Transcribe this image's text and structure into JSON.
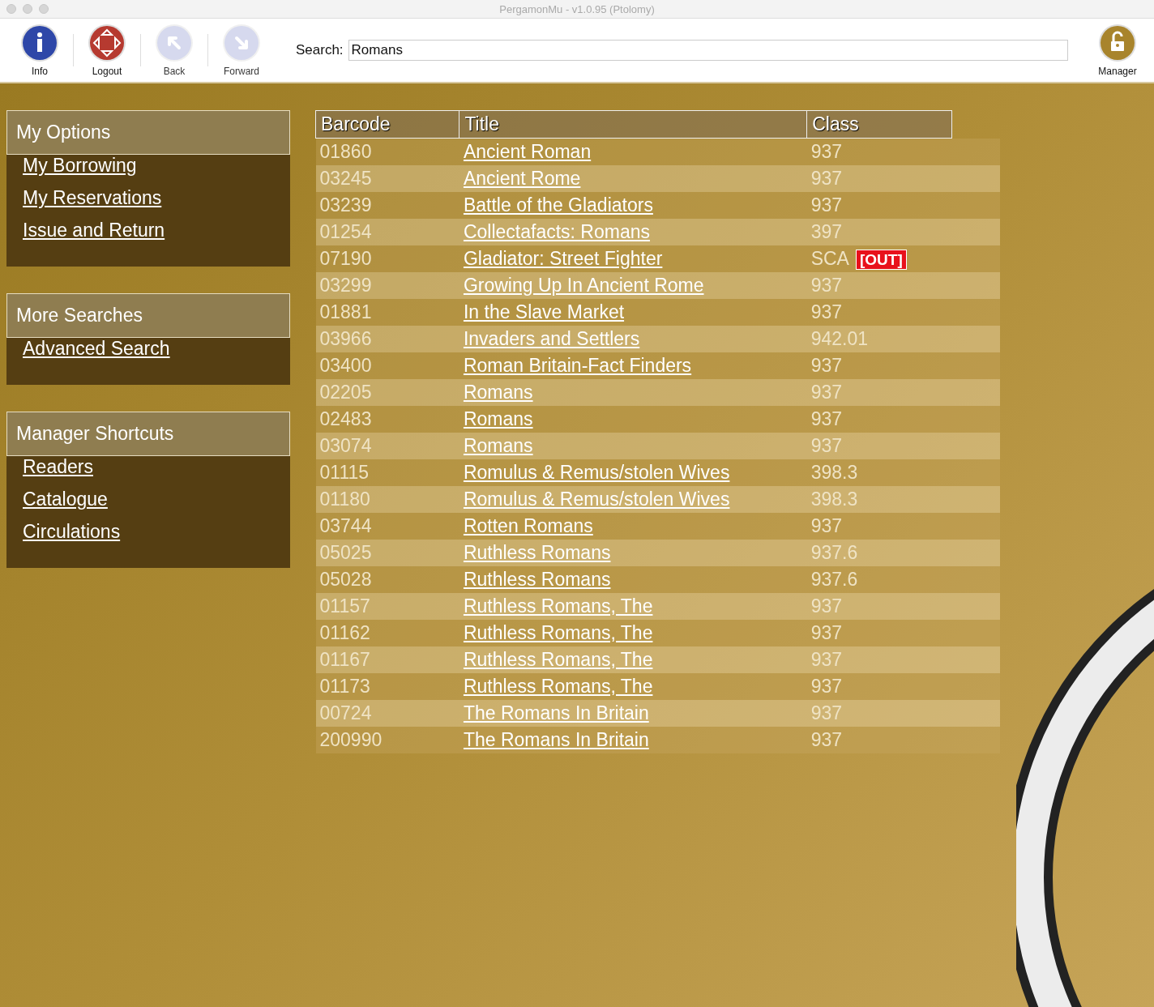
{
  "window": {
    "title": "PergamonMu - v1.0.95 (Ptolomy)"
  },
  "toolbar": {
    "buttons": [
      {
        "kind": "info",
        "label": "Info",
        "disabled": false
      },
      {
        "kind": "logout",
        "label": "Logout",
        "disabled": false
      },
      {
        "kind": "back",
        "label": "Back",
        "disabled": true
      },
      {
        "kind": "forward",
        "label": "Forward",
        "disabled": true
      }
    ],
    "search": {
      "label": "Search:",
      "value": "Romans"
    },
    "manager": {
      "label": "Manager"
    }
  },
  "sidebar": [
    {
      "title": "My Options",
      "links": [
        "My Borrowing",
        "My Reservations",
        "Issue and Return"
      ]
    },
    {
      "title": "More Searches",
      "links": [
        "Advanced Search"
      ]
    },
    {
      "title": "Manager Shortcuts",
      "links": [
        "Readers",
        "Catalogue",
        "Circulations"
      ]
    }
  ],
  "table": {
    "columns": [
      "Barcode",
      "Title",
      "Class"
    ],
    "rows": [
      {
        "barcode": "01860",
        "title": "Ancient Roman",
        "class": "937"
      },
      {
        "barcode": "03245",
        "title": "Ancient Rome",
        "class": "937"
      },
      {
        "barcode": "03239",
        "title": "Battle of the Gladiators",
        "class": "937"
      },
      {
        "barcode": "01254",
        "title": "Collectafacts: Romans",
        "class": "397"
      },
      {
        "barcode": "07190",
        "title": "Gladiator: Street Fighter",
        "class": "SCA",
        "status": "[OUT]"
      },
      {
        "barcode": "03299",
        "title": "Growing Up In Ancient Rome",
        "class": "937"
      },
      {
        "barcode": "01881",
        "title": "In the Slave Market",
        "class": "937"
      },
      {
        "barcode": "03966",
        "title": "Invaders and Settlers",
        "class": "942.01"
      },
      {
        "barcode": "03400",
        "title": "Roman Britain-Fact Finders",
        "class": "937"
      },
      {
        "barcode": "02205",
        "title": "Romans",
        "class": "937"
      },
      {
        "barcode": "02483",
        "title": "Romans",
        "class": "937"
      },
      {
        "barcode": "03074",
        "title": "Romans",
        "class": "937"
      },
      {
        "barcode": "01115",
        "title": "Romulus & Remus/stolen Wives",
        "class": "398.3"
      },
      {
        "barcode": "01180",
        "title": "Romulus & Remus/stolen Wives",
        "class": "398.3"
      },
      {
        "barcode": "03744",
        "title": "Rotten Romans",
        "class": "937"
      },
      {
        "barcode": "05025",
        "title": "Ruthless Romans",
        "class": "937.6"
      },
      {
        "barcode": "05028",
        "title": "Ruthless Romans",
        "class": "937.6"
      },
      {
        "barcode": "01157",
        "title": "Ruthless Romans, The",
        "class": "937"
      },
      {
        "barcode": "01162",
        "title": "Ruthless Romans, The",
        "class": "937"
      },
      {
        "barcode": "01167",
        "title": "Ruthless Romans, The",
        "class": "937"
      },
      {
        "barcode": "01173",
        "title": "Ruthless Romans, The",
        "class": "937"
      },
      {
        "barcode": "00724",
        "title": "The Romans In Britain",
        "class": "937"
      },
      {
        "barcode": "200990",
        "title": "The Romans In Britain",
        "class": "937"
      }
    ]
  }
}
